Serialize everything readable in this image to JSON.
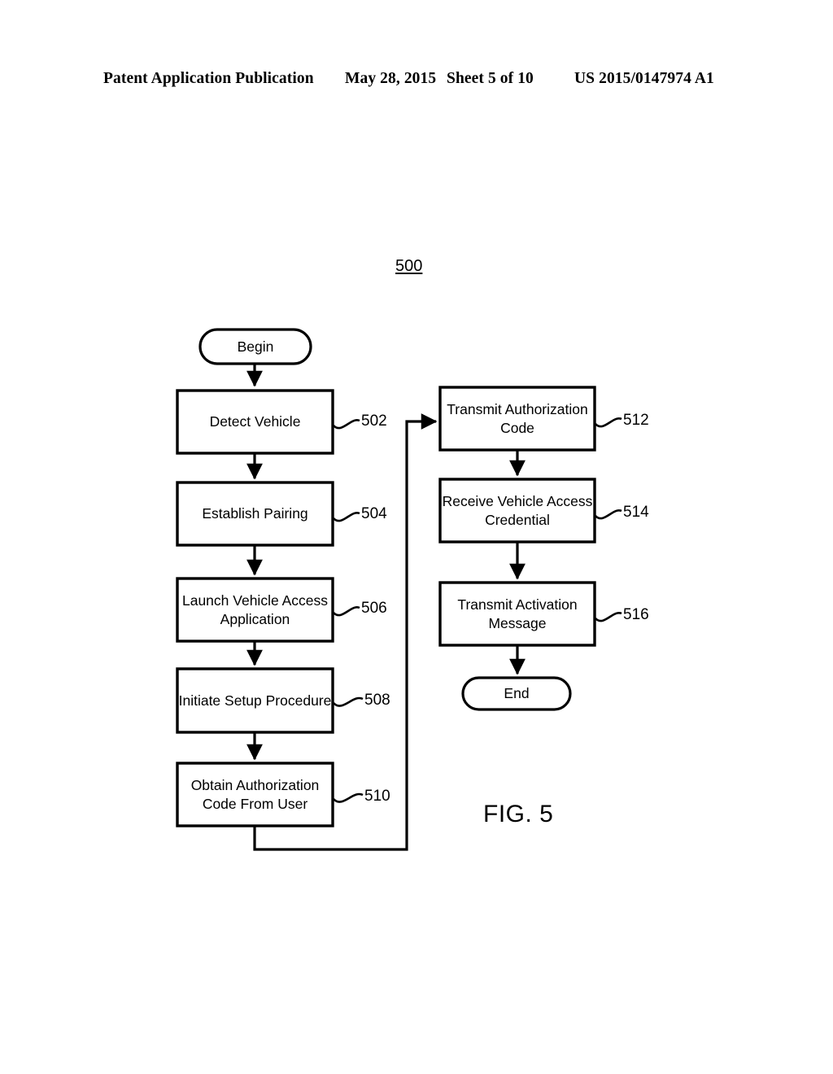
{
  "header": {
    "publication": "Patent Application Publication",
    "date": "May 28, 2015",
    "sheet": "Sheet 5 of 10",
    "patent_number": "US 2015/0147974 A1"
  },
  "figure": {
    "caption": "FIG. 5",
    "diagram_reference": "500"
  },
  "flowchart": {
    "type": "process-flowchart",
    "orientation": "two-column, top-to-bottom, left column then right column",
    "nodes": [
      {
        "id": "begin",
        "shape": "terminator",
        "label": "Begin",
        "ref": ""
      },
      {
        "id": "n502",
        "shape": "process",
        "label": "Detect Vehicle",
        "ref": "502"
      },
      {
        "id": "n504",
        "shape": "process",
        "label": "Establish Pairing",
        "ref": "504"
      },
      {
        "id": "n506",
        "shape": "process",
        "label": "Launch Vehicle Access\nApplication",
        "ref": "506"
      },
      {
        "id": "n508",
        "shape": "process",
        "label": "Initiate Setup Procedure",
        "ref": "508"
      },
      {
        "id": "n510",
        "shape": "process",
        "label": "Obtain Authorization\nCode From User",
        "ref": "510"
      },
      {
        "id": "n512",
        "shape": "process",
        "label": "Transmit Authorization\nCode",
        "ref": "512"
      },
      {
        "id": "n514",
        "shape": "process",
        "label": "Receive Vehicle Access\nCredential",
        "ref": "514"
      },
      {
        "id": "n516",
        "shape": "process",
        "label": "Transmit Activation\nMessage",
        "ref": "516"
      },
      {
        "id": "end",
        "shape": "terminator",
        "label": "End",
        "ref": ""
      }
    ],
    "edges": [
      {
        "from": "begin",
        "to": "n502"
      },
      {
        "from": "n502",
        "to": "n504"
      },
      {
        "from": "n504",
        "to": "n506"
      },
      {
        "from": "n506",
        "to": "n508"
      },
      {
        "from": "n508",
        "to": "n510"
      },
      {
        "from": "n510",
        "to": "n512"
      },
      {
        "from": "n512",
        "to": "n514"
      },
      {
        "from": "n514",
        "to": "n516"
      },
      {
        "from": "n516",
        "to": "end"
      }
    ],
    "colors": {
      "stroke": "#000000",
      "fill": "#ffffff",
      "text": "#000000"
    }
  }
}
